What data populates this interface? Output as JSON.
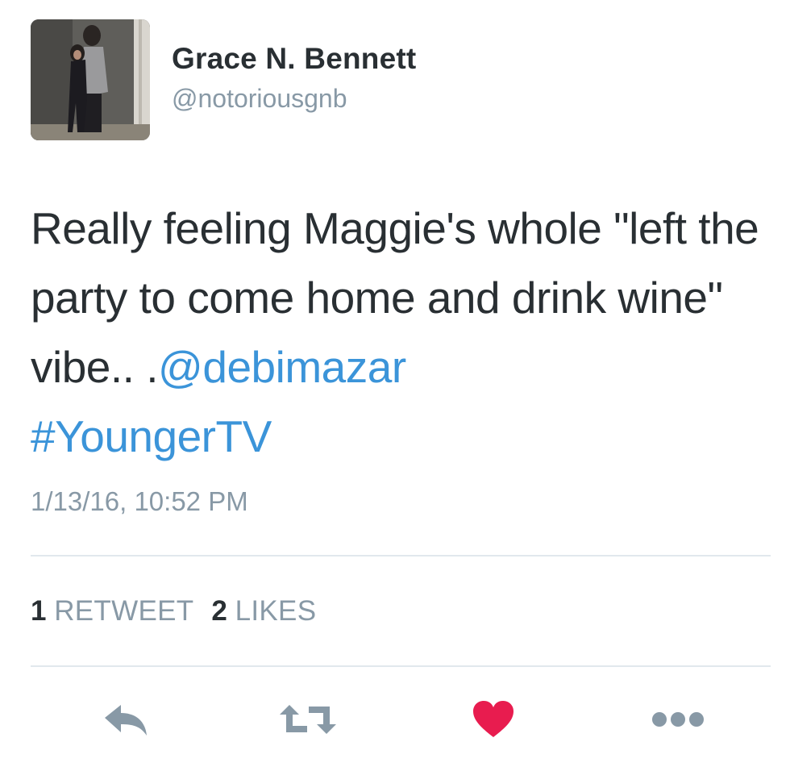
{
  "author": {
    "name": "Grace N. Bennett",
    "handle": "@notoriousgnb"
  },
  "tweet": {
    "text_plain": "Really feeling Maggie's whole \"left the party to come home and drink wine\" vibe.. .",
    "mention": "@debimazar",
    "hashtag": "#YoungerTV",
    "timestamp": "1/13/16, 10:52 PM"
  },
  "stats": {
    "retweets_count": "1",
    "retweets_label": "RETWEET",
    "likes_count": "2",
    "likes_label": "LIKES"
  },
  "actions": {
    "reply_icon": "reply-icon",
    "retweet_icon": "retweet-icon",
    "like_icon": "heart-icon",
    "more_icon": "more-dots-icon"
  },
  "colors": {
    "link": "#3b94d9",
    "secondary_text": "#8899a6",
    "primary_text": "#292f33",
    "like_active": "#e81c4f",
    "divider": "#e1e8ed"
  }
}
